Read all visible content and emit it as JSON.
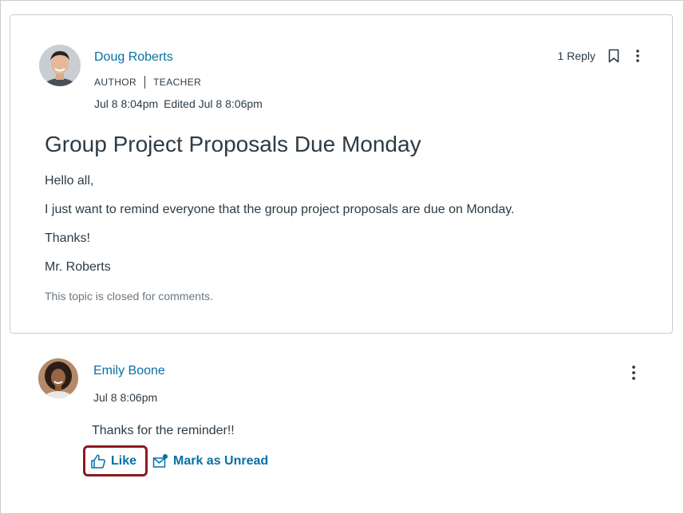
{
  "topic": {
    "author": {
      "name": "Doug Roberts",
      "roles": [
        "AUTHOR",
        "TEACHER"
      ]
    },
    "posted": "Jul 8 8:04pm",
    "edited": "Edited Jul 8 8:06pm",
    "reply_count": "1 Reply",
    "title": "Group Project Proposals Due Monday",
    "body": [
      "Hello all,",
      "I just want to remind everyone that the group project proposals are due on Monday.",
      "Thanks!",
      "Mr. Roberts"
    ],
    "closed_note": "This topic is closed for comments."
  },
  "reply": {
    "author": "Emily Boone",
    "date": "Jul 8 8:06pm",
    "message": "Thanks for the reminder!!",
    "like_label": "Like",
    "mark_unread_label": "Mark as Unread"
  },
  "colors": {
    "link": "#0770a3",
    "text": "#2d3b45",
    "muted": "#6b7780",
    "border": "#c7cdd1",
    "highlight": "#8b1a1e"
  }
}
